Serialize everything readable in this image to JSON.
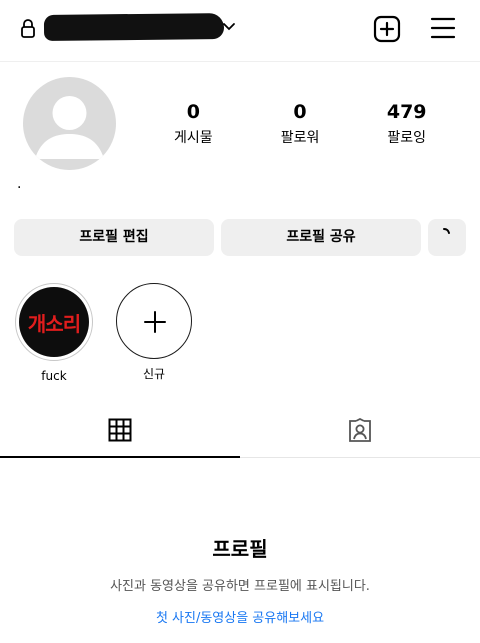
{
  "header": {
    "username": "",
    "icons": {
      "lock": "lock-icon",
      "dropdown": "chevron-down-icon",
      "create": "plus-square-icon",
      "menu": "hamburger-menu-icon"
    }
  },
  "profile": {
    "avatar": "default-avatar",
    "bio": ".",
    "stats": [
      {
        "value": "0",
        "label": "게시물"
      },
      {
        "value": "0",
        "label": "팔로워"
      },
      {
        "value": "479",
        "label": "팔로잉"
      }
    ]
  },
  "actions": {
    "edit_label": "프로필 편집",
    "share_label": "프로필 공유",
    "more_icon": "discover-people-icon"
  },
  "highlights": [
    {
      "cover_text": "개소리",
      "label": "fuck"
    },
    {
      "label": "신규",
      "icon": "plus-icon"
    }
  ],
  "tabs": [
    {
      "name": "posts",
      "icon": "grid-icon",
      "active": true
    },
    {
      "name": "tagged",
      "icon": "tagged-person-icon",
      "active": false
    }
  ],
  "empty_state": {
    "title": "프로필",
    "description": "사진과 동영상을 공유하면 프로필에 표시됩니다.",
    "link": "첫 사진/동영상을 공유해보세요"
  },
  "colors": {
    "link": "#1877f2",
    "button_bg": "#efefef",
    "highlight_text": "#e11d1d"
  }
}
